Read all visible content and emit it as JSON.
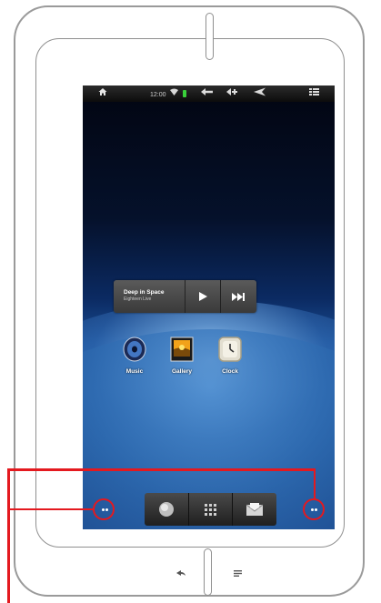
{
  "status_bar": {
    "time": "12:00",
    "icons": [
      "home-icon",
      "wifi-icon",
      "battery-icon",
      "back-icon",
      "volume-up-icon",
      "navigate-back-icon",
      "menu-icon"
    ],
    "battery_color": "#39d13a"
  },
  "music_widget": {
    "title": "Deep in Space",
    "subtitle": "Eighteen Live",
    "play_icon": "play-icon",
    "next_icon": "next-track-icon"
  },
  "apps": [
    {
      "label": "Music",
      "icon": "music-disc-icon"
    },
    {
      "label": "Gallery",
      "icon": "gallery-icon"
    },
    {
      "label": "Clock",
      "icon": "clock-icon"
    }
  ],
  "dock": {
    "items": [
      {
        "icon": "browser-globe-icon"
      },
      {
        "icon": "app-grid-icon"
      },
      {
        "icon": "email-icon"
      }
    ]
  },
  "hardware_buttons": {
    "back_icon": "back-arrow-icon",
    "menu_icon": "menu-lines-icon"
  },
  "callout": {
    "color": "#e4191f",
    "targets": [
      "left-dots-button",
      "right-dots-button"
    ]
  }
}
